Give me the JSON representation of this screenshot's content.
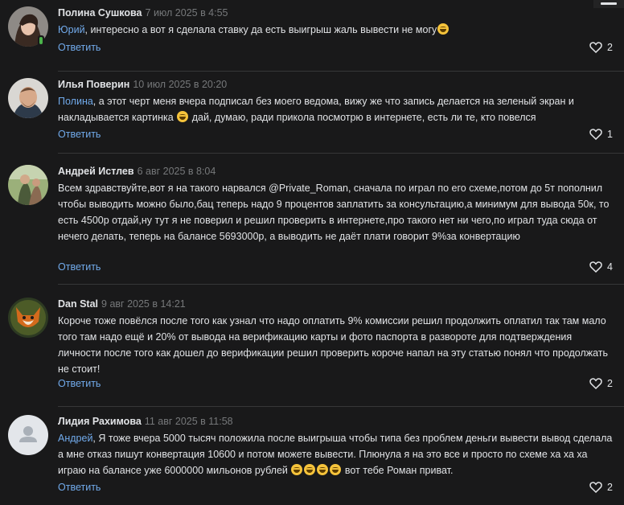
{
  "comments": [
    {
      "author": "Полина Сушкова",
      "date": "7 июл 2025 в 4:55",
      "mention": "Юрий",
      "text": ", интересно а вот я сделала ставку да есть выигрыш жаль вывести не могу",
      "emoji_count": 1,
      "reply_label": "Ответить",
      "likes": "2",
      "online": true
    },
    {
      "author": "Илья Поверин",
      "date": "10 июл 2025 в 20:20",
      "mention": "Полина",
      "text_a": ", а этот черт меня вчера подписал без моего ведома, вижу же что запись делается на зеленый экран и накладывается картинка",
      "text_b": "дай, думаю, ради прикола посмотрю в интернете, есть ли те, кто повелся",
      "reply_label": "Ответить",
      "likes": "1"
    },
    {
      "author": "Андрей Истлев",
      "date": "6 авг 2025 в 8:04",
      "text": "Всем здравствуйте,вот я на такого нарвался @Private_Roman, сначала по играл по его схеме,потом до 5т пополнил чтобы выводить можно было,бац теперь надо 9 процентов заплатить за консультацию,а минимум для вывода 50к, то есть 4500р отдай,ну тут я не поверил и решил проверить в интернете,про такого нет ни чего,по играл туда сюда от нечего делать, теперь на балансе 5693000р, а выводить не даёт плати говорит 9%за конвертацию",
      "reply_label": "Ответить",
      "likes": "4"
    },
    {
      "author": "Dan Stal",
      "date": "9 авг 2025 в 14:21",
      "text": "Короче тоже повёлся после того как узнал что надо оплатить 9% комиссии решил продолжить оплатил так там мало того там надо ещё и 20% от вывода на верификацию карты и фото паспорта в развороте для подтверждения личности после того как дошел до верификации решил проверить короче напал на эту статью понял что продолжать не стоит!",
      "reply_label": "Ответить",
      "likes": "2"
    },
    {
      "author": "Лидия Рахимова",
      "date": "11 авг 2025 в 11:58",
      "mention": "Андрей",
      "text_a": ", Я тоже вчера 5000 тысяч положила после выигрыша чтобы типа без проблем деньги вывести вывод сделала а мне отказ пишут конвертация 10600 и потом можете вывести. Плюнула я на это все и просто по схеме ха ха ха играю на балансе уже 6000000 мильонов рублей",
      "text_b": "вот тебе Роман приват.",
      "reply_label": "Ответить",
      "likes": "2"
    }
  ],
  "icons": {
    "like": "heart-outline-icon",
    "avatar_placeholder": "user-silhouette-icon"
  },
  "colors": {
    "background": "#19191a",
    "link": "#71aaeb",
    "text": "#e1e3e6",
    "muted": "#76787a"
  }
}
